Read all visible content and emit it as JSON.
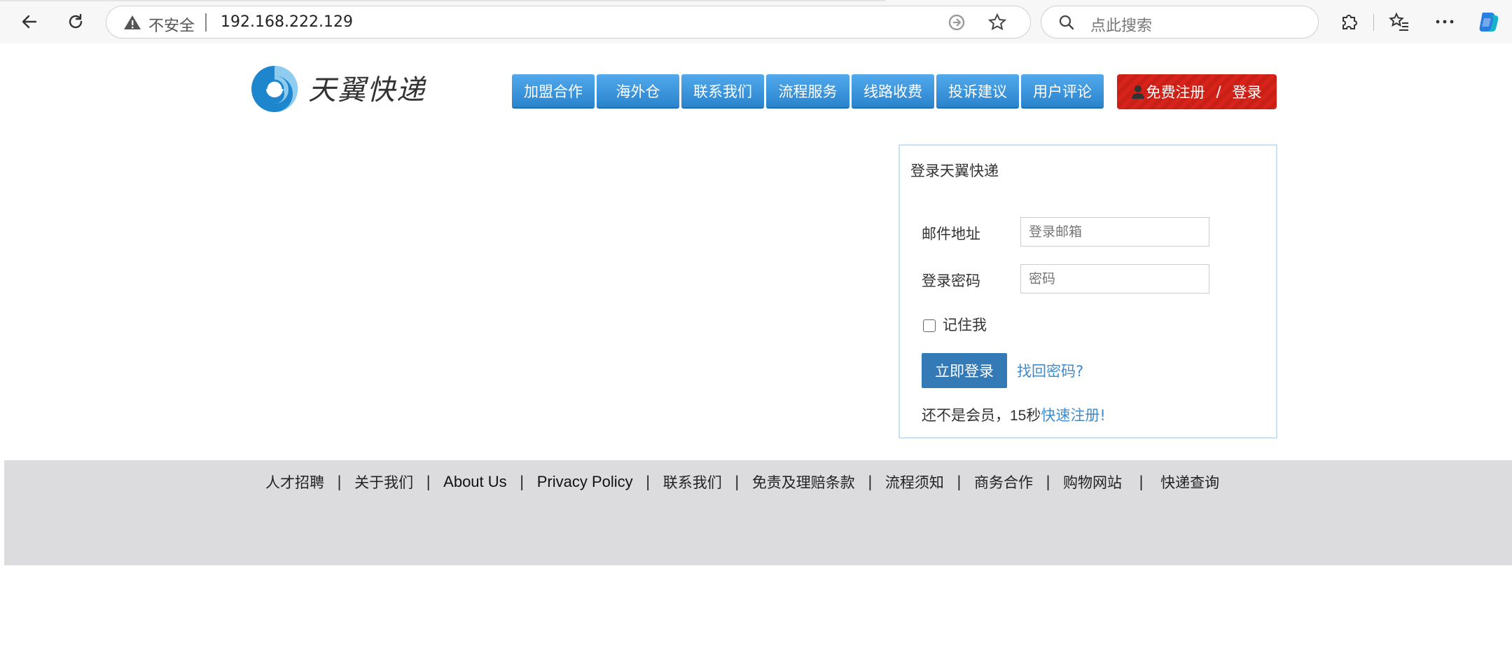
{
  "browser": {
    "security_label": "不安全",
    "url": "192.168.222.129",
    "search_placeholder": "点此搜索"
  },
  "header": {
    "logo_text": "天翼快递",
    "nav": [
      "加盟合作",
      "海外仓",
      "联系我们",
      "流程服务",
      "线路收费",
      "投诉建议",
      "用户评论"
    ],
    "register_label": "免费注册",
    "separator": "/",
    "login_label": "登录"
  },
  "login": {
    "title": "登录天翼快递",
    "email_label": "邮件地址",
    "email_placeholder": "登录邮箱",
    "password_label": "登录密码",
    "password_placeholder": "密码",
    "remember_label": "记住我",
    "submit_label": "立即登录",
    "forgot_label": "找回密码?",
    "not_member_prefix": "还不是会员，",
    "not_member_seconds": "15",
    "not_member_unit": "秒",
    "quick_register": "快速注册!"
  },
  "footer": {
    "links": [
      "人才招聘",
      "关于我们",
      "About Us",
      "Privacy Policy",
      "联系我们",
      "免责及理赔条款",
      "流程须知",
      "商务合作",
      "购物网站",
      "快递查询"
    ],
    "separator": "|"
  },
  "colors": {
    "nav_blue": "#3a95dd",
    "register_red": "#d7231a",
    "button_blue": "#337ab7",
    "link_blue": "#428bca",
    "footer_gray": "#dcdcdf"
  }
}
